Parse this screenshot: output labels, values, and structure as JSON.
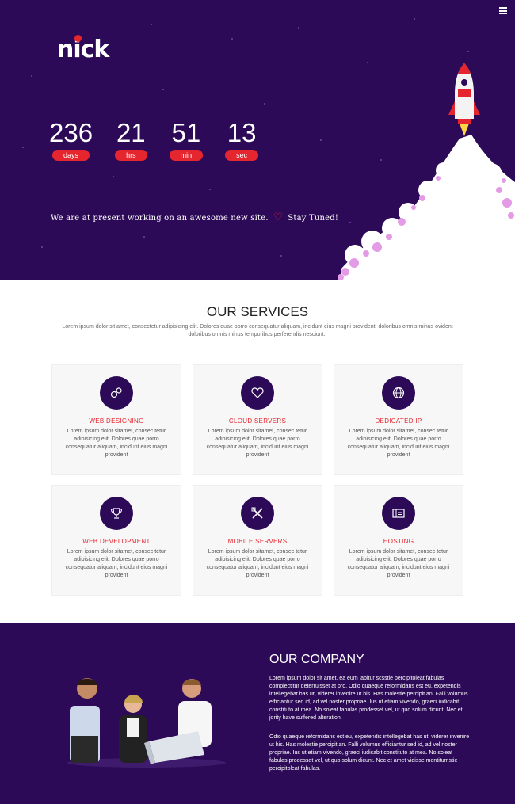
{
  "brand": {
    "logo_text": "nick"
  },
  "countdown": [
    {
      "value": "236",
      "label": "days"
    },
    {
      "value": "21",
      "label": "hrs"
    },
    {
      "value": "51",
      "label": "min"
    },
    {
      "value": "13",
      "label": "sec"
    }
  ],
  "hero": {
    "message_before": "We are at present working on an awesome new site.",
    "message_after": "Stay Tuned!"
  },
  "services": {
    "title": "OUR SERVICES",
    "intro": "Lorem ipsum dolor sit amet, consectetur adipisicing elit. Dolores quae porro consequatur aliquam, incidunt eius magni provident, doloribus omnis minus ovident doloribus omnis minus temporibus perferendis nesciunt..",
    "items": [
      {
        "title": "WEB DESIGNING",
        "icon": "gears-icon",
        "desc": "Lorem ipsum dolor sitamet, consec tetur adipisicing elit. Dolores quae porro consequatur aliquam, incidunt eius magni provident"
      },
      {
        "title": "CLOUD SERVERS",
        "icon": "heart-icon",
        "desc": "Lorem ipsum dolor sitamet, consec tetur adipisicing elit. Dolores quae porro consequatur aliquam, incidunt eius magni provident"
      },
      {
        "title": "DEDICATED IP",
        "icon": "globe-icon",
        "desc": "Lorem ipsum dolor sitamet, consec tetur adipisicing elit. Dolores quae porro consequatur aliquam, incidunt eius magni provident"
      },
      {
        "title": "WEB DEVELOPMENT",
        "icon": "trophy-icon",
        "desc": "Lorem ipsum dolor sitamet, consec tetur adipisicing elit. Dolores quae porro consequatur aliquam, incidunt eius magni provident"
      },
      {
        "title": "MOBILE SERVERS",
        "icon": "tools-icon",
        "desc": "Lorem ipsum dolor sitamet, consec tetur adipisicing elit. Dolores quae porro consequatur aliquam, incidunt eius magni provident"
      },
      {
        "title": "HOSTING",
        "icon": "server-icon",
        "desc": "Lorem ipsum dolor sitamet, consec tetur adipisicing elit. Dolores quae porro consequatur aliquam, incidunt eius magni provident"
      }
    ]
  },
  "company": {
    "title": "OUR COMPANY",
    "p1": "Lorem ipsum dolor sit amet, ea eum labitur scsstie percipitoleat fabulas complectitur deterruisset at pro. Odio quaeque reformidans est eu, expetendis intellegebat has ut, viderer invenire ut his. Has molestie percipit an. Falli volumus efficiantur sed id, ad vel noster propriae. Ius ut etiam vivendo, graeci iudicabit constituto at mea. No soleat fabulas prodesset vel, ut quo solum dicunt. Nec et jority have suffered alteration.",
    "p2": "Odio quaeque reformidans est eu, expetendis intellegebat has ut, viderer invenire ut his. Has molestie percipit an. Falli volumus efficiantur sed id, ad vel noster propriae. Ius ut etiam vivendo, graeci iudicabit constituto at mea. No soleat fabulas prodesset vel, ut quo solum dicunt. Nec et amet vidisse mentitumstie percipitoleat fabulas."
  },
  "colors": {
    "primary": "#2c0a57",
    "accent": "#e6262e",
    "card_bg": "#f7f7f7"
  }
}
